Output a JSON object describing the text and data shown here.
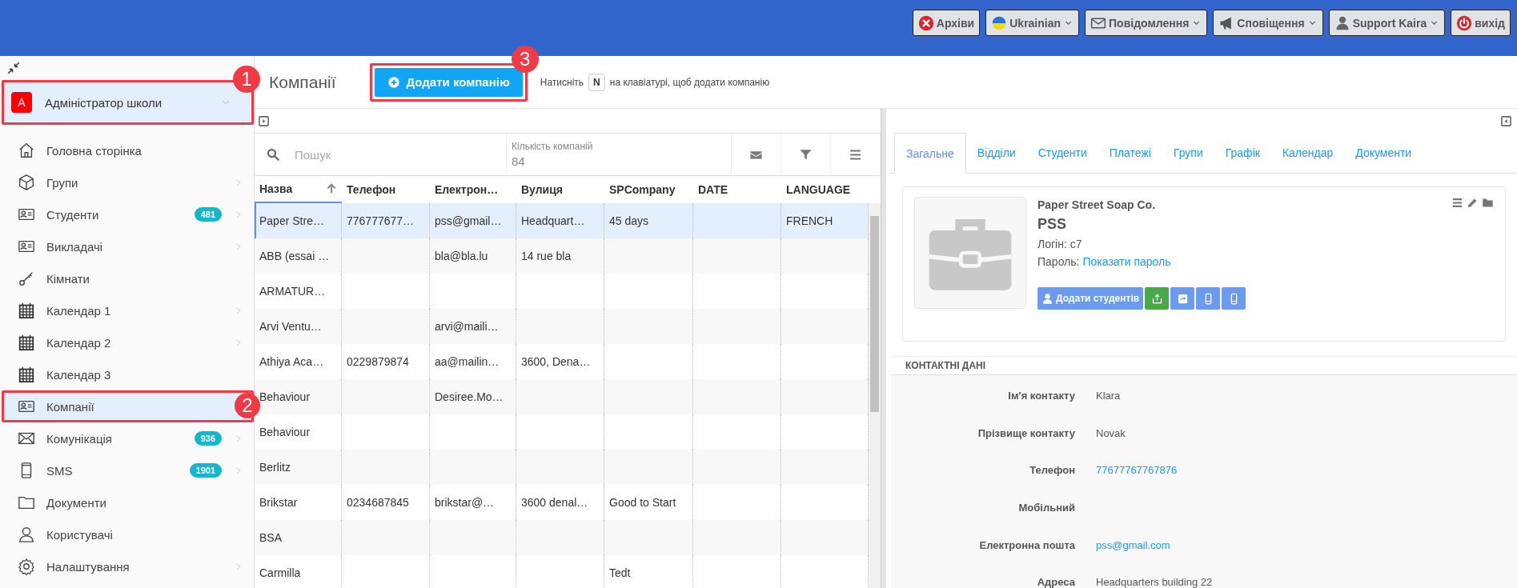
{
  "top_bar": {
    "buttons": [
      {
        "label": "Архіви",
        "dropdown": false
      },
      {
        "label": "Ukrainian",
        "dropdown": true
      },
      {
        "label": "Повідомлення",
        "dropdown": true
      },
      {
        "label": "Сповіщення",
        "dropdown": true
      },
      {
        "label": "Support Kaira",
        "dropdown": true
      },
      {
        "label": "вихід",
        "dropdown": false
      }
    ]
  },
  "sidebar": {
    "profile": {
      "initial": "A",
      "name": "Адміністратор школи",
      "callout": "1"
    },
    "items": [
      {
        "label": "Головна сторінка",
        "submenu": false,
        "selected": false
      },
      {
        "label": "Групи",
        "submenu": true,
        "selected": false
      },
      {
        "label": "Студенти",
        "submenu": true,
        "selected": false,
        "badge": "481"
      },
      {
        "label": "Викладачі",
        "submenu": true,
        "selected": false
      },
      {
        "label": "Кімнати",
        "submenu": false,
        "selected": false
      },
      {
        "label": "Календар 1",
        "submenu": true,
        "selected": false
      },
      {
        "label": "Календар 2",
        "submenu": true,
        "selected": false
      },
      {
        "label": "Календар 3",
        "submenu": false,
        "selected": false
      },
      {
        "label": "Компанії",
        "submenu": false,
        "selected": true,
        "callout": "2"
      },
      {
        "label": "Комунікація",
        "submenu": true,
        "selected": false,
        "badge": "936"
      },
      {
        "label": "SMS",
        "submenu": true,
        "selected": false,
        "badge": "1901"
      },
      {
        "label": "Документи",
        "submenu": false,
        "selected": false
      },
      {
        "label": "Користувачі",
        "submenu": false,
        "selected": false
      },
      {
        "label": "Налаштування",
        "submenu": true,
        "selected": false
      }
    ]
  },
  "header": {
    "title": "Компанії",
    "add_button": {
      "label": "Додати компанію",
      "callout": "3"
    },
    "hint": {
      "before": "Натисніть",
      "key": "N",
      "after": "на клавіатурі, щоб додати компанію"
    }
  },
  "table": {
    "search": {
      "placeholder": "Пошук"
    },
    "count": {
      "label": "Кількість компаній",
      "value": "84"
    },
    "columns": [
      {
        "label": "Назва",
        "sorted": true
      },
      {
        "label": "Телефон",
        "sorted": false
      },
      {
        "label": "Електрон…",
        "sorted": false
      },
      {
        "label": "Вулиця",
        "sorted": false
      },
      {
        "label": "SPCompany",
        "sorted": false
      },
      {
        "label": "DATE",
        "sorted": false
      },
      {
        "label": "LANGUAGE",
        "sorted": false
      }
    ],
    "rows": [
      {
        "selected": true,
        "name": "Paper Stre…",
        "phone": "776777677…",
        "email": "pss@gmail…",
        "street": "Headquart…",
        "spcompany": "45 days",
        "language": "FRENCH"
      },
      {
        "selected": false,
        "name": "ABB (essai …",
        "email": "bla@bla.lu",
        "street": "14 rue bla"
      },
      {
        "selected": false,
        "name": "ARMATUR…"
      },
      {
        "selected": false,
        "name": "Arvi Ventu…",
        "email": "arvi@maili…"
      },
      {
        "selected": false,
        "name": "Athiya Aca…",
        "phone": "0229879874",
        "email": "aa@mailin…",
        "street": "3600, Dena…"
      },
      {
        "selected": false,
        "name": "Behaviour",
        "email": "Desiree.Mo…"
      },
      {
        "selected": false,
        "name": "Behaviour"
      },
      {
        "selected": false,
        "name": "Berlitz"
      },
      {
        "selected": false,
        "name": "Brikstar",
        "phone": "0234687845",
        "email": "brikstar@…",
        "street": "3600 denal…",
        "spcompany": "Good to Start"
      },
      {
        "selected": false,
        "name": "BSA"
      },
      {
        "selected": false,
        "name": "Carmilla",
        "spcompany": "Tedt"
      }
    ]
  },
  "details": {
    "tabs": [
      {
        "label": "Загальне",
        "selected": true
      },
      {
        "label": "Відділи",
        "selected": false
      },
      {
        "label": "Студенти",
        "selected": false
      },
      {
        "label": "Платежі",
        "selected": false
      },
      {
        "label": "Групи",
        "selected": false
      },
      {
        "label": "Графік",
        "selected": false
      },
      {
        "label": "Календар",
        "selected": false
      },
      {
        "label": "Документи",
        "selected": false
      }
    ],
    "card": {
      "name": "Paper Street Soap Co.",
      "code": "PSS",
      "login_label": "Логін:",
      "login": "c7",
      "password_label": "Пароль:",
      "password_link": "Показати пароль",
      "add_students_button": "Додати студентів"
    },
    "contacts": {
      "title": "КОНТАКТНІ ДАНІ",
      "fields": [
        {
          "label": "Ім'я контакту",
          "value": "Klara",
          "kind": "text"
        },
        {
          "label": "Прізвище контакту",
          "value": "Novak",
          "kind": "text"
        },
        {
          "label": "Телефон",
          "value": "77677767767876",
          "kind": "link"
        },
        {
          "label": "Мобільний",
          "kind": "text"
        },
        {
          "label": "Електронна пошта",
          "value": "pss@gmail.com",
          "kind": "link"
        },
        {
          "label": "Адреса",
          "value": "Headquarters building 22",
          "kind": "text"
        }
      ]
    }
  }
}
